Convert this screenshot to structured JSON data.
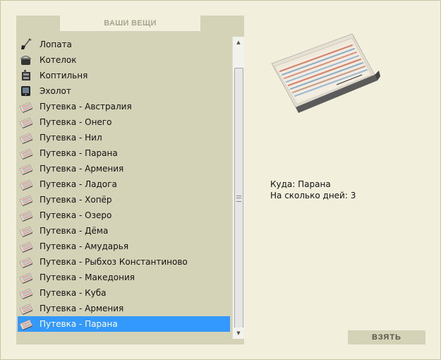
{
  "panel": {
    "title": "ВАШИ ВЕЩИ"
  },
  "items": [
    {
      "label": "Лопата",
      "icon": "shovel-icon"
    },
    {
      "label": "Котелок",
      "icon": "pot-icon"
    },
    {
      "label": "Коптильня",
      "icon": "smokehouse-icon"
    },
    {
      "label": "Эхолот",
      "icon": "echo-sounder-icon"
    },
    {
      "label": "Путевка - Австралия",
      "icon": "voucher-icon"
    },
    {
      "label": "Путевка - Онего",
      "icon": "voucher-icon"
    },
    {
      "label": "Путевка - Нил",
      "icon": "voucher-icon"
    },
    {
      "label": "Путевка - Парана",
      "icon": "voucher-icon"
    },
    {
      "label": "Путевка - Армения",
      "icon": "voucher-icon"
    },
    {
      "label": "Путевка - Ладога",
      "icon": "voucher-icon"
    },
    {
      "label": "Путевка - Хопёр",
      "icon": "voucher-icon"
    },
    {
      "label": "Путевка - Озеро",
      "icon": "voucher-icon"
    },
    {
      "label": "Путевка - Дёма",
      "icon": "voucher-icon"
    },
    {
      "label": "Путевка - Амударья",
      "icon": "voucher-icon"
    },
    {
      "label": "Путевка - Рыбхоз Константиново",
      "icon": "voucher-icon"
    },
    {
      "label": "Путевка - Македония",
      "icon": "voucher-icon"
    },
    {
      "label": "Путевка - Куба",
      "icon": "voucher-icon"
    },
    {
      "label": "Путевка - Армения",
      "icon": "voucher-icon"
    },
    {
      "label": "Путевка - Парана",
      "icon": "voucher-icon",
      "selected": true
    }
  ],
  "details": {
    "destination_line": "Куда: Парана",
    "days_line": "На сколько дней: 3"
  },
  "actions": {
    "take_label": "ВЗЯТЬ"
  },
  "colors": {
    "background": "#f2f0dc",
    "panel": "#d5d3b7",
    "selection": "#3399ff"
  }
}
